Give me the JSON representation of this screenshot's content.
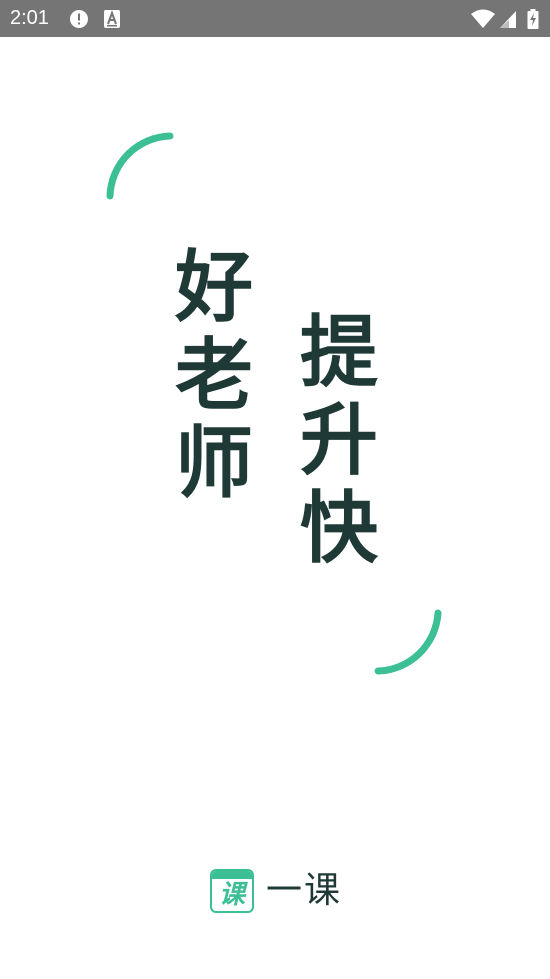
{
  "status_bar": {
    "time": "2:01",
    "icons": [
      "alert-icon",
      "a-notification-icon",
      "wifi-icon",
      "signal-icon",
      "battery-charging-icon"
    ],
    "background": "#757575"
  },
  "slogan": {
    "left_column": [
      "好",
      "老",
      "师"
    ],
    "right_column": [
      "提",
      "升",
      "快"
    ],
    "text_color": "#1f3a36"
  },
  "decoration": {
    "accent_color": "#3dbf96"
  },
  "logo": {
    "icon_char": "课",
    "brand_name": "一课"
  }
}
